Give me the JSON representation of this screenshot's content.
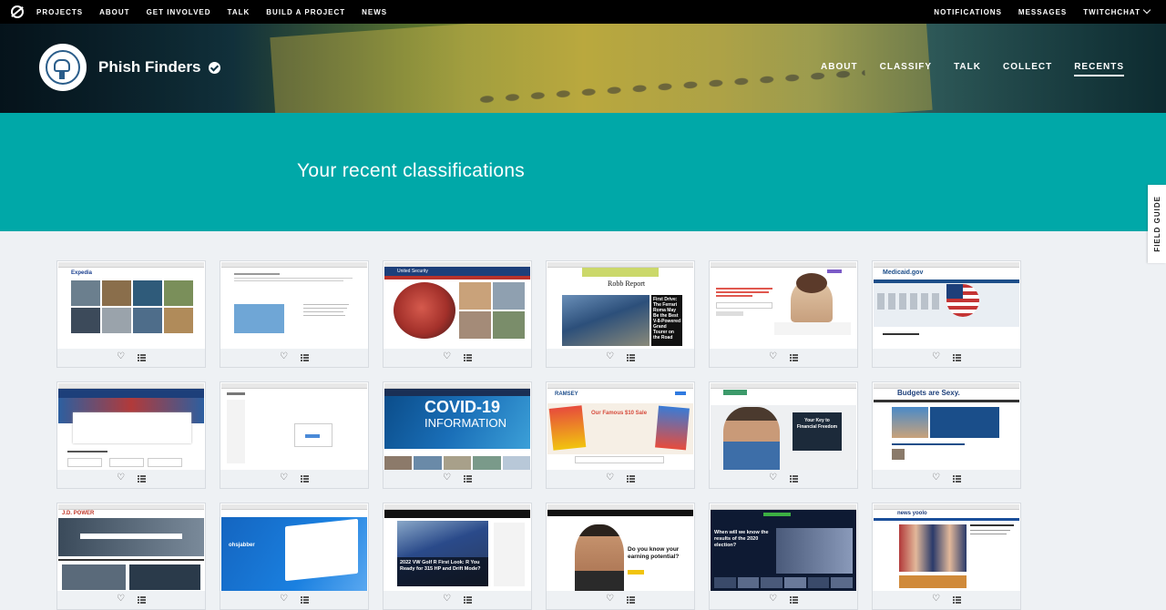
{
  "topnav": {
    "links": [
      "PROJECTS",
      "ABOUT",
      "GET INVOLVED",
      "TALK",
      "BUILD A PROJECT",
      "NEWS"
    ],
    "right": [
      "NOTIFICATIONS",
      "MESSAGES",
      "TWITCHCHAT"
    ]
  },
  "project": {
    "title": "Phish Finders",
    "nav": [
      "ABOUT",
      "CLASSIFY",
      "TALK",
      "COLLECT",
      "RECENTS"
    ],
    "active_nav": "RECENTS"
  },
  "banner": {
    "title": "Your recent classifications"
  },
  "field_guide": "FIELD GUIDE",
  "thumbs": {
    "t1_logo": "Expedia",
    "t3_title": "United Security",
    "t4_logo": "Robb Report",
    "t4_headline": "First Drive: The Ferrari Roma May Be the Best V-8-Powered Grand Tourer on the Road",
    "t6_logo": "Medicaid.gov",
    "t9_line1": "COVID-19",
    "t9_line2": "INFORMATION",
    "t10_logo": "RAMSEY",
    "t10_sale": "Our Famous $10 Sale",
    "t11_panel": "Your Key to Financial Freedom",
    "t12_title": "Budgets are Sexy.",
    "t13_logo": "J.D. POWER",
    "t14_logo": "ohsjabber",
    "t15_caption": "2022 VW Golf R First Look: R You Ready for 315 HP and Drift Mode?",
    "t16_headline": "Do you know your earning potential?",
    "t17_caption": "When will we know the results of the 2020 election?",
    "t18_logo": "news yoolo"
  },
  "colors": {
    "teal": "#00a8a8",
    "topnav": "#000000",
    "page_bg": "#eef1f4"
  }
}
